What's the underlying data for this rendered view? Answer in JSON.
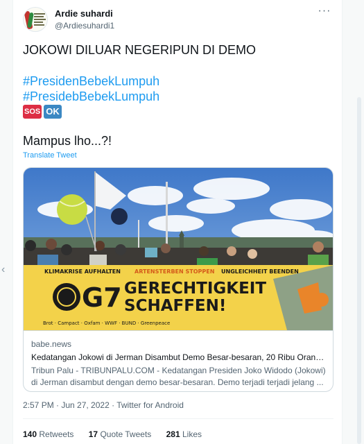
{
  "tweet": {
    "author": {
      "name": "Ardie suhardi",
      "handle": "@Ardiesuhardi1"
    },
    "lines": [
      "JOKOWI DILUAR NEGERIPUN DI DEMO",
      "#PresidenBebekLumpuh",
      "#PresidebBebekLumpuh"
    ],
    "emoji": [
      "SOS",
      "OK"
    ],
    "closing_line": "Mampus lho...?!",
    "translate_label": "Translate Tweet",
    "card": {
      "domain": "babe.news",
      "title": "Kedatangan Jokowi di Jerman Disambut Demo Besar-besaran, 20 Ribu Orang T...",
      "description": "Tribun Palu - TRIBUNPALU.COM - Kedatangan Presiden Joko Widodo (Jokowi) di Jerman disambut dengan demo besar-besaran. Demo terjadi terjadi jelang ...",
      "image": {
        "banner_slogan_1": "KLIMAKRISE AUFHALTEN",
        "banner_slogan_2": "ARTENSTERBEN STOPPEN",
        "banner_slogan_3": "UNGLEICHHEIT BEENDEN",
        "banner_logo": "G7",
        "banner_main_1": "GERECHTIGKEIT",
        "banner_main_2": "SCHAFFEN!",
        "sponsors": "Brot · Campact · Oxfam · WWF · BUND · Greenpeace"
      }
    },
    "timestamp": "2:57 PM · Jun 27, 2022 · Twitter for Android",
    "stats": {
      "retweets_count": "140",
      "retweets_label": "Retweets",
      "quotes_count": "17",
      "quotes_label": "Quote Tweets",
      "likes_count": "281",
      "likes_label": "Likes"
    }
  },
  "colors": {
    "link": "#1d9bf0",
    "secondary_text": "#536471",
    "banner_yellow": "#f3d24a",
    "banner_orange": "#e9852a"
  }
}
